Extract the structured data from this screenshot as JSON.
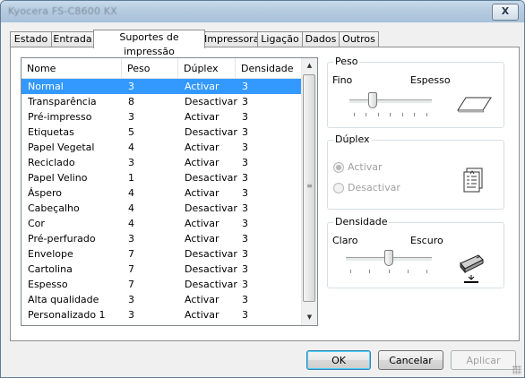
{
  "window": {
    "title": "Kyocera FS-C8600 KX",
    "close_label": "X"
  },
  "tabs": [
    {
      "label": "Estado"
    },
    {
      "label": "Entrada"
    },
    {
      "label": "Suportes de impressão"
    },
    {
      "label": "Impressora"
    },
    {
      "label": "Ligação"
    },
    {
      "label": "Dados"
    },
    {
      "label": "Outros"
    }
  ],
  "active_tab_index": 2,
  "media_list": {
    "columns": [
      "Nome",
      "Peso",
      "Dúplex",
      "Densidade"
    ],
    "selected_index": 0,
    "rows": [
      [
        "Normal",
        "3",
        "Activar",
        "3"
      ],
      [
        "Transparência",
        "8",
        "Desactivar",
        "3"
      ],
      [
        "Pré-impresso",
        "3",
        "Activar",
        "3"
      ],
      [
        "Etiquetas",
        "5",
        "Desactivar",
        "3"
      ],
      [
        "Papel Vegetal",
        "4",
        "Activar",
        "3"
      ],
      [
        "Reciclado",
        "3",
        "Activar",
        "3"
      ],
      [
        "Papel Velino",
        "1",
        "Desactivar",
        "3"
      ],
      [
        "Áspero",
        "4",
        "Activar",
        "3"
      ],
      [
        "Cabeçalho",
        "4",
        "Desactivar",
        "3"
      ],
      [
        "Cor",
        "4",
        "Activar",
        "3"
      ],
      [
        "Pré-perfurado",
        "3",
        "Activar",
        "3"
      ],
      [
        "Envelope",
        "7",
        "Desactivar",
        "3"
      ],
      [
        "Cartolina",
        "7",
        "Desactivar",
        "3"
      ],
      [
        "Espesso",
        "7",
        "Desactivar",
        "3"
      ],
      [
        "Alta qualidade",
        "3",
        "Activar",
        "3"
      ],
      [
        "Personalizado 1",
        "3",
        "Activar",
        "3"
      ]
    ]
  },
  "peso": {
    "label": "Peso",
    "min_label": "Fino",
    "max_label": "Espesso",
    "value_fraction": 0.28,
    "icon": "paper-sheet-icon"
  },
  "duplex": {
    "label": "Dúplex",
    "options": [
      "Activar",
      "Desactivar"
    ],
    "selected": "Activar",
    "enabled": false,
    "icon": "duplex-document-icon"
  },
  "densidade": {
    "label": "Densidade",
    "min_label": "Claro",
    "max_label": "Escuro",
    "value_fraction": 0.5,
    "icon": "toner-cartridge-icon"
  },
  "buttons": {
    "ok": "OK",
    "cancel": "Cancelar",
    "apply": "Aplicar"
  },
  "colors": {
    "selection": "#3399ff",
    "titlebar": "#b5cbe0"
  }
}
